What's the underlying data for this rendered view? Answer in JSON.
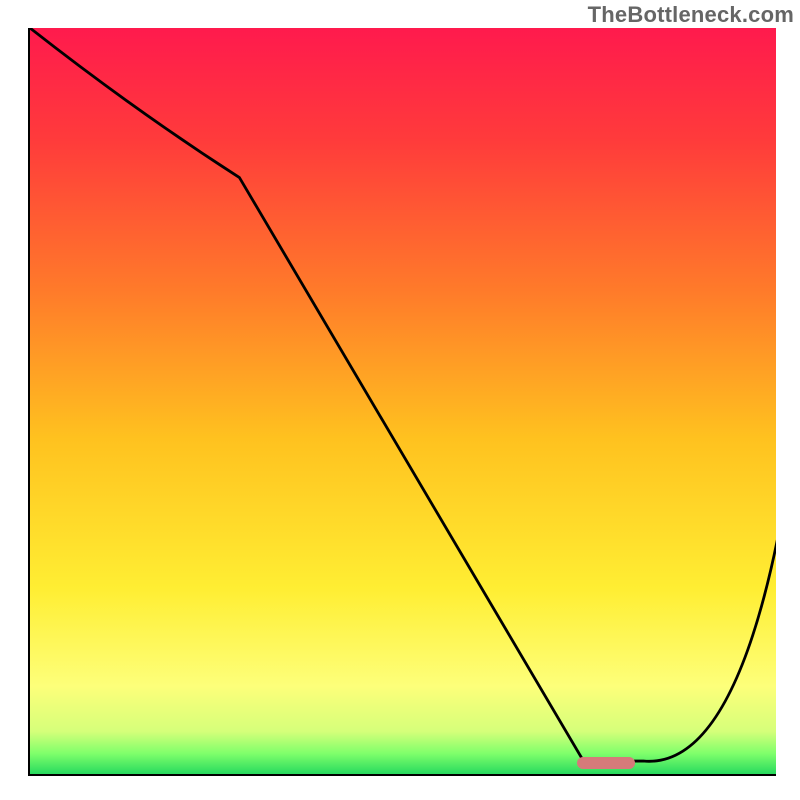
{
  "attribution": "TheBottleneck.com",
  "gradient": {
    "stops": [
      {
        "offset": 0.0,
        "color": "#ff1a4d"
      },
      {
        "offset": 0.15,
        "color": "#ff3b3b"
      },
      {
        "offset": 0.35,
        "color": "#ff7a2a"
      },
      {
        "offset": 0.55,
        "color": "#ffc21f"
      },
      {
        "offset": 0.75,
        "color": "#ffee33"
      },
      {
        "offset": 0.88,
        "color": "#fdff7a"
      },
      {
        "offset": 0.94,
        "color": "#d6ff7a"
      },
      {
        "offset": 0.97,
        "color": "#7fff6b"
      },
      {
        "offset": 1.0,
        "color": "#1fd65d"
      }
    ]
  },
  "marker": {
    "x_frac": 0.77,
    "y_frac": 0.982,
    "w_frac": 0.078,
    "h_frac": 0.016,
    "color": "#d67a7a"
  },
  "chart_data": {
    "type": "line",
    "title": "",
    "xlabel": "",
    "ylabel": "",
    "xlim": [
      0,
      100
    ],
    "ylim": [
      0,
      100
    ],
    "series": [
      {
        "name": "curve",
        "x": [
          0,
          28,
          74,
          82,
          100
        ],
        "values": [
          100,
          80,
          2,
          2,
          32
        ]
      }
    ],
    "gradient_band": {
      "top_color_desc": "red (high bottleneck)",
      "bottom_color_desc": "green (low bottleneck)"
    }
  }
}
